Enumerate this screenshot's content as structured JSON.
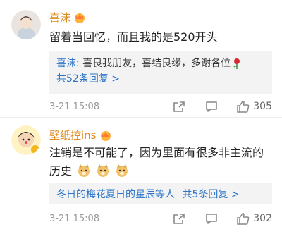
{
  "comments": [
    {
      "username": "喜沫",
      "text": "留着当回忆，而且我的是520开头",
      "reply_user": "喜沫",
      "reply_text": ": 喜良我朋友，喜结良缘，多谢各位",
      "reply_emoji": "rose-icon",
      "more_label": "共52条回复 >",
      "time": "3-21 15:08",
      "likes": "305"
    },
    {
      "username": "壁纸控ins",
      "text_line1": "注销是不可能了，因为里面有很多非主流的",
      "text_line2": "历史",
      "reply_summary": "冬日的梅花夏日的星辰等人",
      "reply_count": "共5条回复",
      "reply_arrow": ">",
      "time": "3-21 15:08",
      "likes": "302"
    }
  ],
  "colors": {
    "name": "#e08a1e",
    "link": "#2b74c7",
    "reply_bg": "#f3f3f3",
    "meta": "#999999"
  },
  "icons": [
    "vip-crown-icon",
    "share-icon",
    "comment-icon",
    "like-icon",
    "doge-emoji-icon"
  ]
}
